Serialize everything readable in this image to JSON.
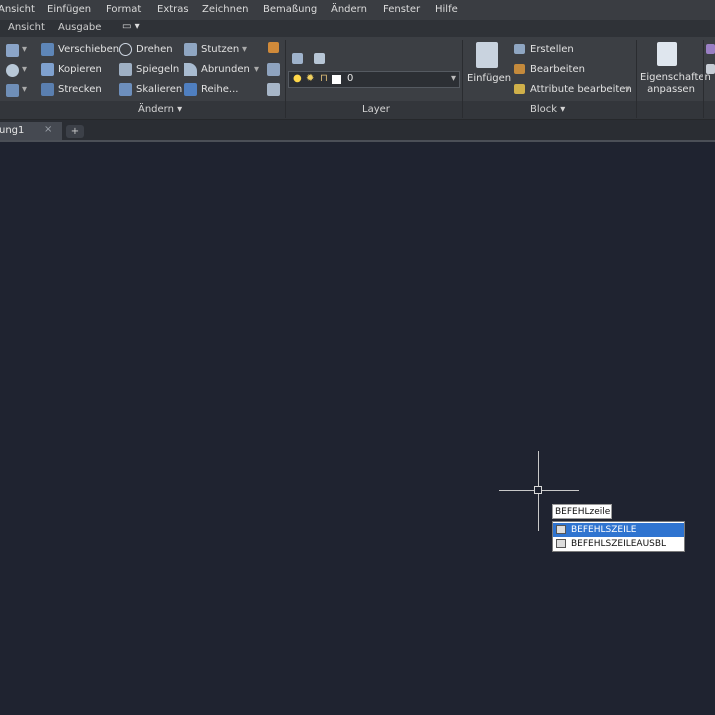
{
  "menu": [
    "Ansicht",
    "Einfügen",
    "Format",
    "Extras",
    "Zeichnen",
    "Bemaßung",
    "Ändern",
    "Fenster",
    "Hilfe"
  ],
  "ribbon_tabs": [
    "Ansicht",
    "Ausgabe"
  ],
  "modify_panel": {
    "col1": [
      "Verschieben",
      "Kopieren",
      "Strecken"
    ],
    "col2": [
      "Drehen",
      "Spiegeln",
      "Skalieren"
    ],
    "col3": [
      "Stutzen",
      "Abrunden",
      "Reihe..."
    ],
    "title": "Ändern"
  },
  "layer_panel": {
    "current_layer": "0",
    "title": "Layer"
  },
  "block_panel": {
    "insert_label": "Einfügen",
    "items": [
      "Erstellen",
      "Bearbeiten",
      "Attribute bearbeiten"
    ],
    "title": "Block"
  },
  "properties": {
    "line1": "Eigenschaften",
    "line2": "anpassen"
  },
  "doc_tab": {
    "label": "ung1",
    "close": "×",
    "new": "+"
  },
  "command": {
    "input_value": "BEFEHLzeile",
    "suggestions": [
      "BEFEHLSZEILE",
      "BEFEHLSZEILEAUSBL"
    ]
  },
  "colors": {
    "canvas": "#1f2330",
    "highlight": "#2f74d0",
    "ribbon": "#3c3f44"
  }
}
